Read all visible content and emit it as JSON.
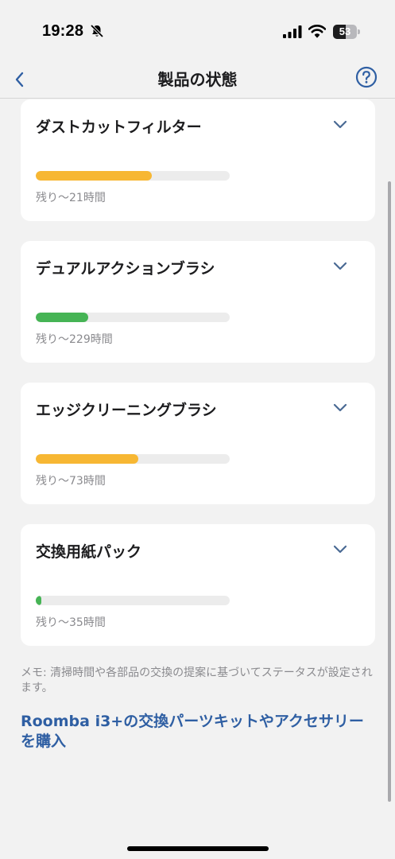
{
  "status_bar": {
    "time": "19:28",
    "battery_level": "53",
    "battery_fraction": 0.53
  },
  "nav": {
    "title": "製品の状態"
  },
  "parts": [
    {
      "name": "ダストカットフィルター",
      "remaining": "残り～21時間",
      "level": 0.6,
      "color": "#f7b733"
    },
    {
      "name": "デュアルアクションブラシ",
      "remaining": "残り～229時間",
      "level": 0.27,
      "color": "#46b455"
    },
    {
      "name": "エッジクリーニングブラシ",
      "remaining": "残り～73時間",
      "level": 0.53,
      "color": "#f7b733"
    },
    {
      "name": "交換用紙パック",
      "remaining": "残り～35時間",
      "level": 0.03,
      "color": "#46b455"
    }
  ],
  "note": "メモ: 清掃時間や各部品の交換の提案に基づいてステータスが設定されます。",
  "buy_link": "Roomba i3+の交換パーツキットやアクセサリーを購入",
  "colors": {
    "accent": "#2f5fa3",
    "warning": "#f7b733",
    "good": "#46b455"
  }
}
